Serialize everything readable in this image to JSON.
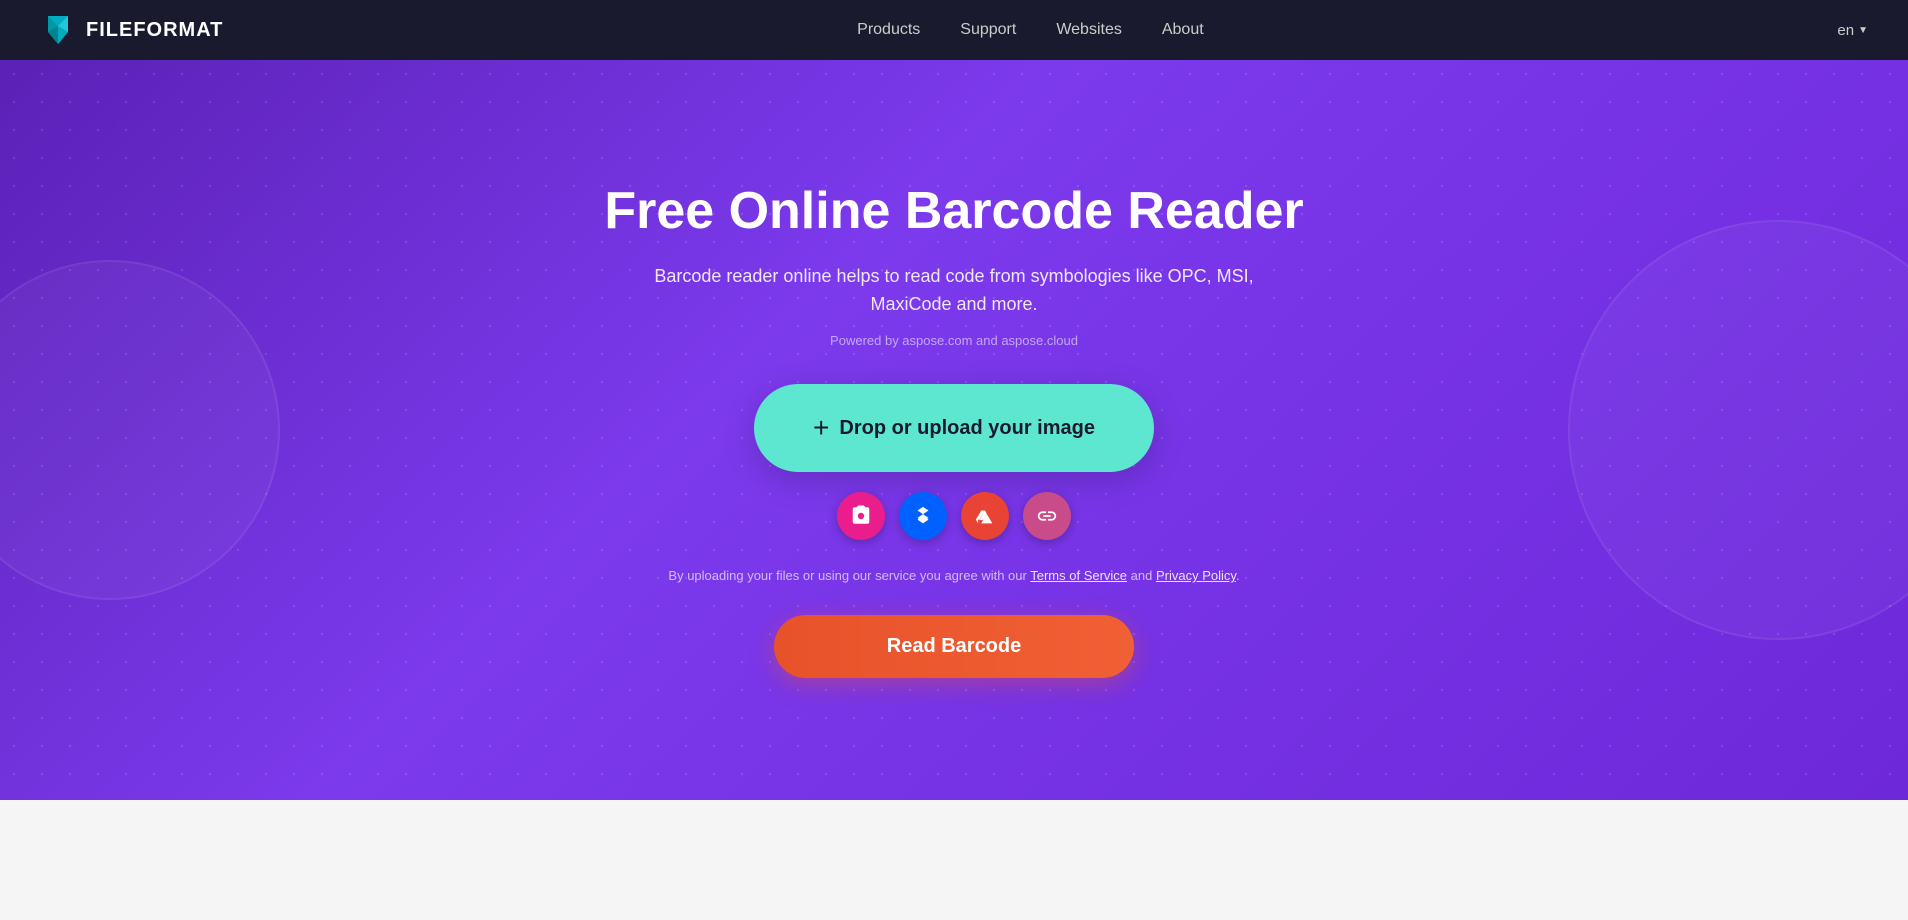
{
  "nav": {
    "logo_text": "FILEFORMAT",
    "links": [
      {
        "label": "Products",
        "href": "#"
      },
      {
        "label": "Support",
        "href": "#"
      },
      {
        "label": "Websites",
        "href": "#"
      },
      {
        "label": "About",
        "href": "#"
      }
    ],
    "language": "en"
  },
  "hero": {
    "title": "Free Online Barcode Reader",
    "subtitle": "Barcode reader online helps to read code from symbologies like OPC, MSI, MaxiCode and more.",
    "powered": "Powered by aspose.com and aspose.cloud",
    "upload_label": "Drop or upload your image",
    "tos_text": "By uploading your files or using our service you agree with our",
    "tos_link1": "Terms of Service",
    "tos_and": "and",
    "tos_link2": "Privacy Policy",
    "tos_dot": ".",
    "read_btn_label": "Read Barcode",
    "source_icons": [
      {
        "name": "camera",
        "label": "Camera"
      },
      {
        "name": "dropbox",
        "label": "Dropbox"
      },
      {
        "name": "gdrive",
        "label": "Google Drive"
      },
      {
        "name": "link",
        "label": "URL Link"
      }
    ]
  },
  "colors": {
    "hero_bg": "#6d28d9",
    "upload_bg": "#5ee7d0",
    "read_btn": "#e8522a",
    "camera_btn": "#e91e8c",
    "dropbox_btn": "#0061ff",
    "gdrive_btn": "#e84335",
    "link_btn": "#c94b8a"
  }
}
